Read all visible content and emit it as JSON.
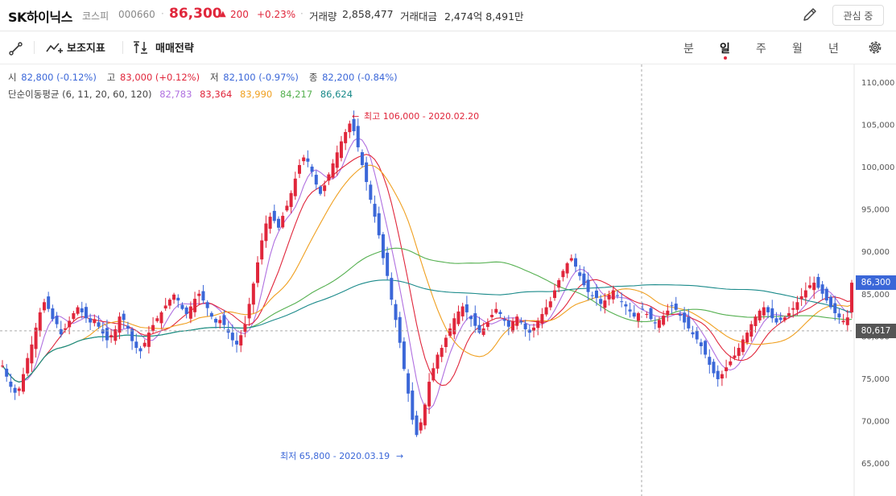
{
  "header": {
    "stock_name": "SK하이닉스",
    "market": "코스피",
    "code": "000660",
    "price": "86,300",
    "change_arrow": "▲",
    "change": "200",
    "change_pct": "+0.23%",
    "volume_label": "거래량",
    "volume": "2,858,477",
    "amount_label": "거래대금",
    "amount": "2,474억 8,491만",
    "watch_button": "관심 중"
  },
  "toolbar": {
    "indicators": "보조지표",
    "strategy": "매매전략",
    "periods": [
      "분",
      "일",
      "주",
      "월",
      "년"
    ],
    "active_period": "일"
  },
  "ohlc": {
    "open_label": "시",
    "open": "82,800 (-0.12%)",
    "high_label": "고",
    "high": "83,000 (+0.12%)",
    "low_label": "저",
    "low": "82,100 (-0.97%)",
    "close_label": "종",
    "close": "82,200 (-0.84%)"
  },
  "ma": {
    "label": "단순이동평균 (6, 11, 20, 60, 120)",
    "values": [
      "82,783",
      "83,364",
      "83,990",
      "84,217",
      "86,624"
    ],
    "colors": [
      "#b070e0",
      "#e0263b",
      "#f0a020",
      "#55b050",
      "#1a8a8a"
    ]
  },
  "chart_data": {
    "type": "candlestick",
    "y_ticks": [
      "110,000",
      "105,000",
      "100,000",
      "95,000",
      "90,000",
      "85,000",
      "80,000",
      "75,000",
      "70,000",
      "65,000"
    ],
    "ylim": [
      63000,
      111000
    ],
    "current_price_tag": "86,300",
    "crosshair_tag": "80,617",
    "high_annotation": "최고 106,000 - 2020.02.20",
    "low_annotation": "최저 65,800 - 2020.03.19",
    "up_color": "#e0263b",
    "down_color": "#3b67d8",
    "closes": [
      76500,
      75200,
      74000,
      73300,
      73800,
      75500,
      77400,
      79000,
      81000,
      82800,
      84000,
      83200,
      82000,
      81400,
      80200,
      80900,
      81800,
      82700,
      83400,
      82800,
      82100,
      81600,
      82000,
      81100,
      80300,
      79500,
      80100,
      80800,
      82300,
      81900,
      80900,
      79400,
      78600,
      78200,
      79200,
      80400,
      81300,
      82100,
      82800,
      83600,
      84300,
      84900,
      84200,
      83200,
      82600,
      83500,
      84400,
      85000,
      84200,
      83300,
      82300,
      81600,
      81900,
      81300,
      80400,
      79500,
      79000,
      80100,
      81400,
      83800,
      86200,
      88700,
      91300,
      93300,
      94100,
      93600,
      92800,
      94200,
      95400,
      96900,
      98600,
      100200,
      101100,
      100600,
      99400,
      97900,
      96800,
      97800,
      99100,
      100400,
      101700,
      103000,
      104100,
      105100,
      104200,
      102300,
      100200,
      98200,
      96100,
      94100,
      91900,
      89200,
      87100,
      84300,
      81900,
      79200,
      76100,
      73200,
      70100,
      68300,
      69800,
      71900,
      74600,
      76200,
      77800,
      78600,
      79800,
      80900,
      82100,
      82900,
      83500,
      82800,
      82000,
      81200,
      80400,
      80900,
      81600,
      82500,
      83200,
      82600,
      81800,
      81100,
      81700,
      82300,
      81600,
      80800,
      80400,
      81000,
      81800,
      82600,
      83400,
      84100,
      85400,
      86600,
      87700,
      88600,
      89200,
      88200,
      87100,
      86000,
      85200,
      84800,
      84500,
      83800,
      84200,
      84900,
      85400,
      84800,
      84100,
      83500,
      82900,
      82300,
      82700,
      83200,
      82600,
      82000,
      81500,
      81900,
      82400,
      83000,
      83600,
      83100,
      82400,
      81600,
      80900,
      80200,
      79600,
      78800,
      77800,
      76600,
      75600,
      74900,
      75500,
      76300,
      77000,
      77700,
      78600,
      79600,
      80400,
      81400,
      82300,
      83000,
      83400,
      82800,
      82100,
      81600,
      81900,
      82200,
      82700,
      83300,
      84000,
      84700,
      85400,
      86000,
      86300,
      85700,
      85000,
      84200,
      83400,
      82700,
      82200,
      81800,
      82200,
      86300
    ]
  }
}
